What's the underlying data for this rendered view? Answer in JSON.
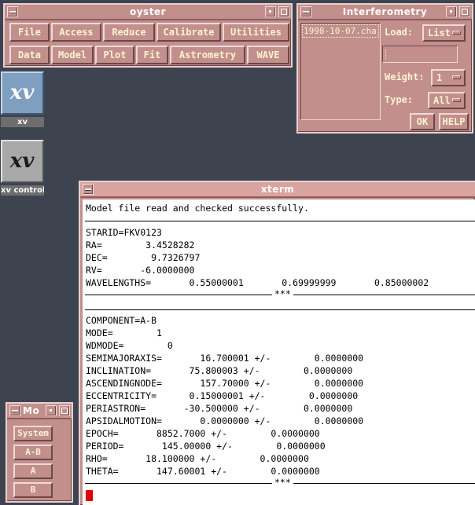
{
  "oyster": {
    "title": "oyster",
    "row1": [
      "File",
      "Access",
      "Reduce",
      "Calibrate",
      "Utilities"
    ],
    "row2": [
      "Data",
      "Model",
      "Plot",
      "Fit",
      "Astrometry",
      "WAVE"
    ]
  },
  "interferometry": {
    "title": "Interferometry",
    "file_item": "1998-10-07.cha",
    "load_label": "Load:",
    "load_value": "List",
    "weight_label": "Weight:",
    "weight_value": "1",
    "type_label": "Type:",
    "type_value": "All",
    "ok": "OK",
    "help": "HELP"
  },
  "icons": {
    "xv_label": "xv",
    "xv_control_label": "xv controls"
  },
  "small_window": {
    "title": "Mo",
    "buttons": [
      "System",
      "A-B",
      "A",
      "B"
    ]
  },
  "xterm": {
    "title": "xterm",
    "message": "Model file read and checked successfully.",
    "block1": [
      "STARID=FKV0123",
      "RA=        3.4528282",
      "DEC=        9.7326797",
      "RV=       -6.0000000",
      "WAVELENGTHS=       0.55000001       0.69999999       0.85000002"
    ],
    "block2": [
      "COMPONENT=A-B",
      "MODE=        1",
      "WDMODE=        0",
      "SEMIMAJORAXIS=       16.700001 +/-        0.0000000",
      "INCLINATION=       75.800003 +/-        0.0000000",
      "ASCENDINGNODE=       157.70000 +/-        0.0000000",
      "ECCENTRICITY=      0.15000001 +/-        0.0000000",
      "PERIASTRON=       -30.500000 +/-        0.0000000",
      "APSIDALMOTION=       0.0000000 +/-        0.0000000",
      "EPOCH=       8852.7000 +/-        0.0000000",
      "PERIOD=       145.00000 +/-        0.0000000",
      "RHO=       18.100000 +/-        0.0000000",
      "THETA=       147.60001 +/-        0.0000000"
    ],
    "separator": "***"
  },
  "colors": {
    "desktop": "#3d4450",
    "window": "#c28f8d",
    "button_text": "#fdf3cf",
    "cursor": "#e00000"
  }
}
